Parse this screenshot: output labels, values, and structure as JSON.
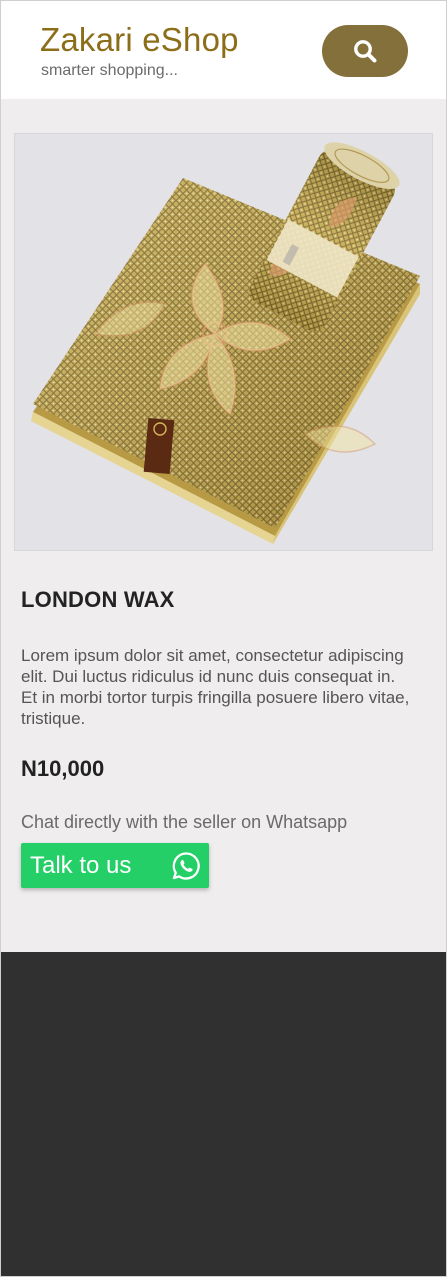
{
  "header": {
    "title": "Zakari eShop",
    "tagline": "smarter shopping...",
    "search_icon": "search-icon"
  },
  "product": {
    "image_alt": "fabric-image",
    "name": "LONDON WAX",
    "description": "Lorem ipsum dolor sit amet, consectetur adipiscing elit. Dui luctus ridiculus id nunc duis consequat in. Et in morbi tortor turpis fringilla posuere libero vitae, tristique.",
    "price": "N10,000"
  },
  "contact": {
    "note": "Chat directly with the seller on Whatsapp",
    "button_label": "Talk to us",
    "button_icon": "whatsapp-icon"
  },
  "colors": {
    "brand": "#8c6d1a",
    "search_button": "#84703a",
    "whatsapp": "#25cf68",
    "content_bg": "#efedee",
    "footer_bg": "#303030"
  }
}
